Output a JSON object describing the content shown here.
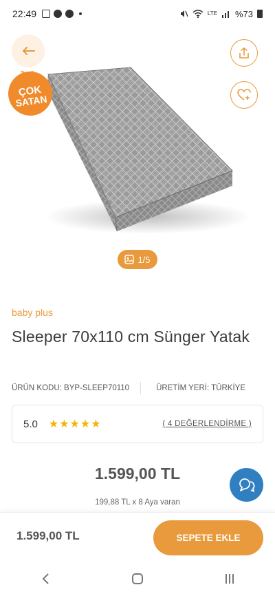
{
  "status_bar": {
    "time": "22:49",
    "battery": "%73",
    "network_label": "LTE"
  },
  "badge": {
    "line1": "ÇOK",
    "line2": "SATAN"
  },
  "gallery": {
    "counter": "1/5"
  },
  "product": {
    "brand": "baby plus",
    "title": "Sleeper 70x110 cm Sünger Yatak",
    "code": "ÜRÜN KODU: BYP-SLEEP70110",
    "origin": "ÜRETİM YERİ: TÜRKİYE",
    "rating": "5.0",
    "stars": "★★★★★",
    "reviews": "( 4 DEĞERLENDİRME )",
    "price": "1.599,00 TL",
    "installment": "199,88 TL x 8 Aya varan"
  },
  "bottom_bar": {
    "price": "1.599,00 TL",
    "add_to_cart": "SEPETE EKLE"
  },
  "colors": {
    "accent": "#e89a3c",
    "badge": "#f08a2a",
    "chat": "#2f7fc1",
    "star": "#f5b400"
  }
}
